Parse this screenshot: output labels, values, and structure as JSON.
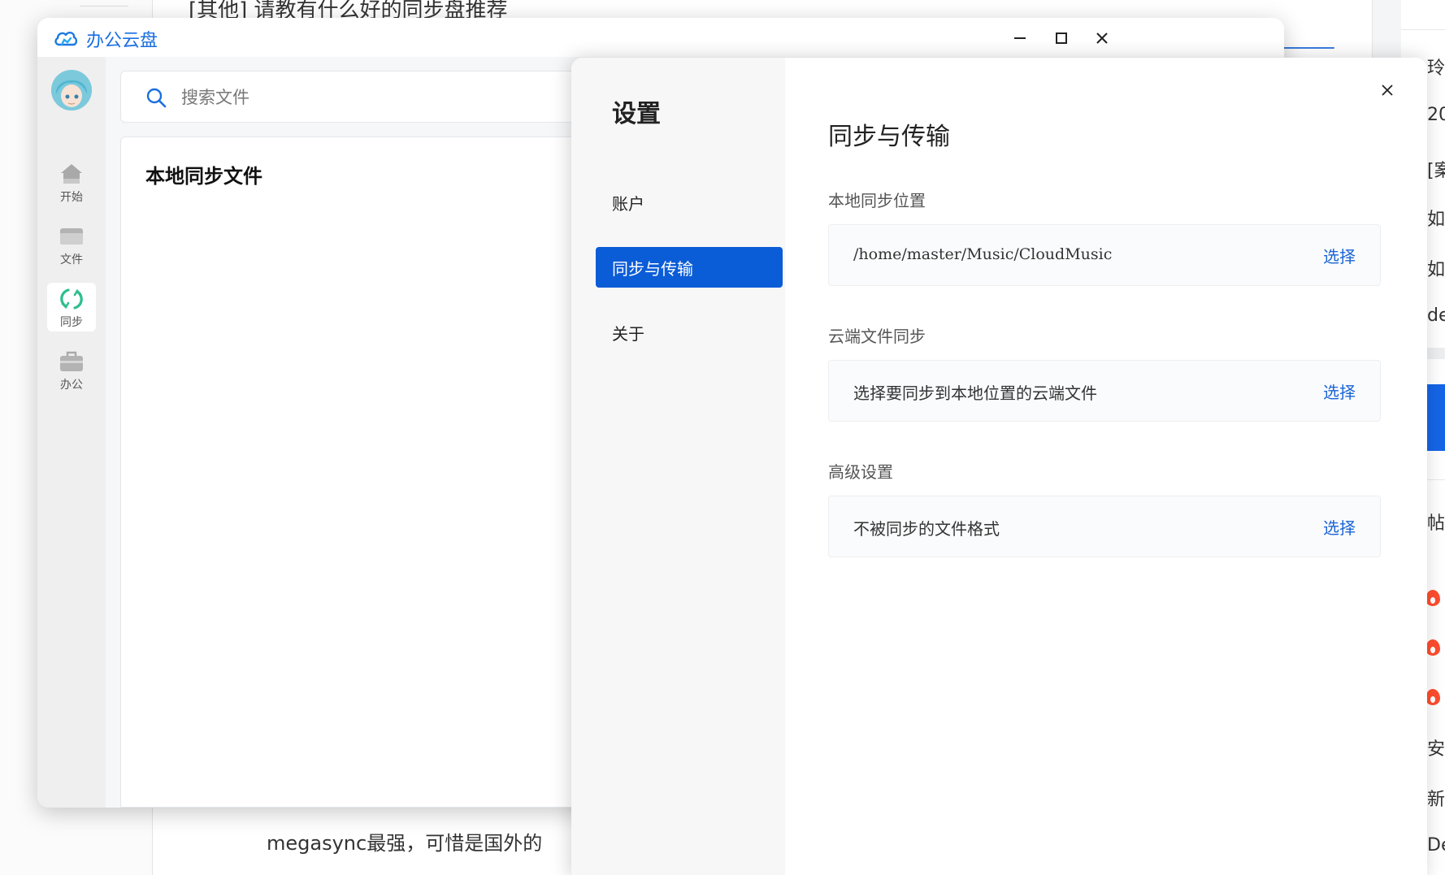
{
  "background_page": {
    "post_title": "[其他] 请教有什么好的同步盘推荐",
    "reply_text": "megasync最强，可惜是国外的",
    "right_column": [
      "玲",
      "20",
      "[案",
      "如",
      "如",
      "de",
      "帖",
      "安",
      "新",
      "De"
    ]
  },
  "window": {
    "title": "办公云盘",
    "logo_icon": "cloud-icon",
    "controls": {
      "minimize_icon": "minimize-icon",
      "maximize_icon": "maximize-icon",
      "close_icon": "close-icon"
    }
  },
  "rail": {
    "items": [
      {
        "label": "开始",
        "icon": "home-icon",
        "active": false
      },
      {
        "label": "文件",
        "icon": "folder-icon",
        "active": false
      },
      {
        "label": "同步",
        "icon": "sync-icon",
        "active": true
      },
      {
        "label": "办公",
        "icon": "briefcase-icon",
        "active": false
      }
    ]
  },
  "search": {
    "placeholder": "搜索文件",
    "value": ""
  },
  "content": {
    "title": "本地同步文件"
  },
  "settings": {
    "title": "设置",
    "nav": [
      {
        "label": "账户",
        "active": false
      },
      {
        "label": "同步与传输",
        "active": true
      },
      {
        "label": "关于",
        "active": false
      }
    ],
    "heading": "同步与传输",
    "sections": [
      {
        "label": "本地同步位置",
        "value": "/home/master/Music/CloudMusic",
        "action": "选择"
      },
      {
        "label": "云端文件同步",
        "value": "选择要同步到本地位置的云端文件",
        "action": "选择"
      },
      {
        "label": "高级设置",
        "value": "不被同步的文件格式",
        "action": "选择"
      }
    ],
    "accent_color": "#0b5cd7",
    "link_color": "#1a64d6"
  }
}
